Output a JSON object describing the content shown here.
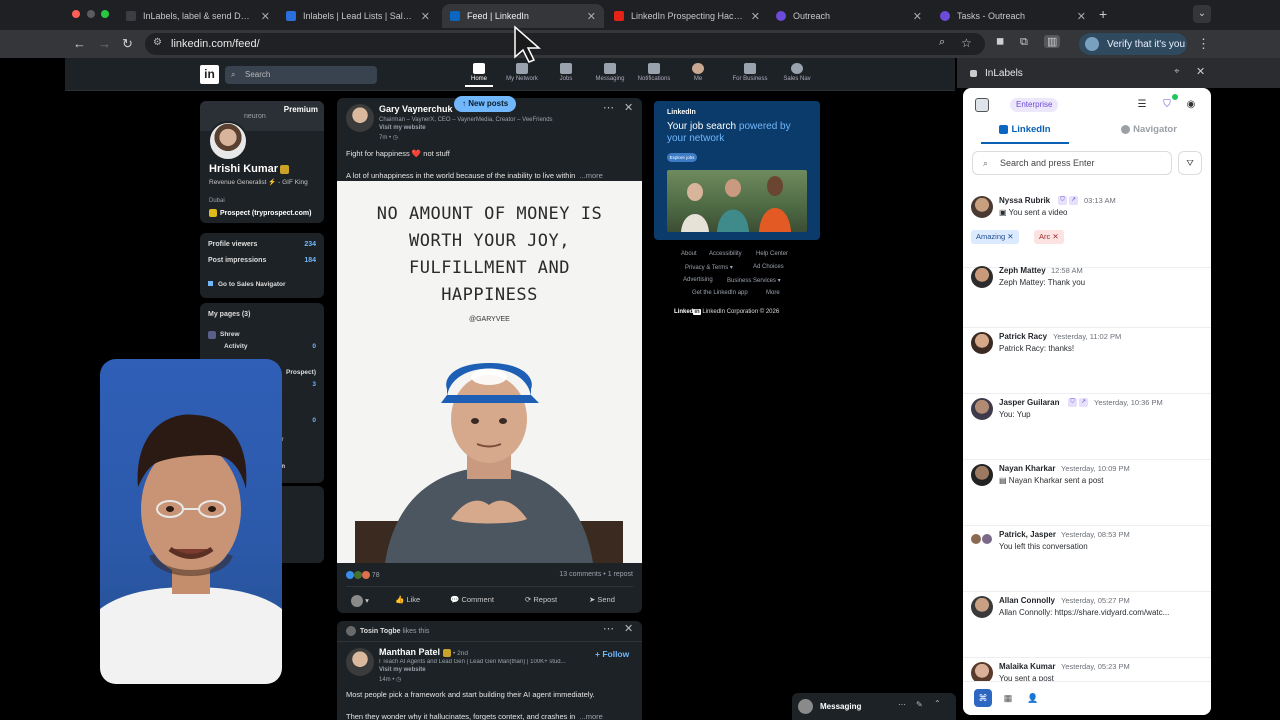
{
  "browser": {
    "tabs": [
      {
        "title": "InLabels, label & send DMs w",
        "color": "#3b3d42"
      },
      {
        "title": "Inlabels | Lead Lists | Sales N",
        "color": "#2a6fdb"
      },
      {
        "title": "Feed | LinkedIn",
        "color": "#0a66c2",
        "active": true
      },
      {
        "title": "LinkedIn Prospecting Hack to",
        "color": "#e62117"
      },
      {
        "title": "Outreach",
        "color": "#6b4bd8"
      },
      {
        "title": "Tasks - Outreach",
        "color": "#6b4bd8"
      }
    ],
    "url": "linkedin.com/feed/",
    "profile_button": "Verify that it's you"
  },
  "linkedin": {
    "search_placeholder": "Search",
    "nav": [
      "Home",
      "My Network",
      "Jobs",
      "Messaging",
      "Notifications",
      "Me",
      "For Business",
      "Sales Nav"
    ],
    "new_posts": "New posts",
    "profile": {
      "premium": "Premium",
      "banner_brand": "neuron",
      "name": "Hrishi Kumar",
      "headline": "Revenue Generalist ⚡ - GIF King",
      "location": "Dubai",
      "company": "Prospect (tryprospect.com)",
      "stats": [
        {
          "label": "Profile viewers",
          "value": "234"
        },
        {
          "label": "Post impressions",
          "value": "184"
        }
      ],
      "sales_nav": "Go to Sales Navigator",
      "pages_title": "My pages (3)",
      "pages": [
        {
          "name": "Shrew",
          "sub": "Activity",
          "count": "0"
        }
      ],
      "pages_partial": [
        "Prospect)",
        "3",
        "0",
        "er",
        "lin"
      ]
    },
    "post1": {
      "author": "Gary Vaynerchuk",
      "sub": "Chairman – VaynerX, CEO – VaynerMedia, Creator – VeeFriends",
      "visit": "Visit my website",
      "time": "7m • ◷",
      "line1": "Fight for happiness ❤️ not stuff",
      "line2": "A lot of unhappiness in the world because of the inability to live within",
      "more": "...more",
      "quote": "NO AMOUNT OF MONEY IS WORTH YOUR JOY, FULFILLMENT AND HAPPINESS",
      "signature": "@GARYVEE",
      "reactions_count": "78",
      "comments": "13 comments • 1 repost",
      "actions": [
        "Like",
        "Comment",
        "Repost",
        "Send"
      ]
    },
    "post2": {
      "liked_by": "Tosin Togbe",
      "liked_suffix": "likes this",
      "author": "Manthan Patel",
      "degree": "• 2nd",
      "follow": "+ Follow",
      "sub": "I Teach AI Agents and Lead Gen | Lead Gen Man(than) | 100K+ stud...",
      "visit": "Visit my website",
      "time": "14m • ◷",
      "line1": "Most people pick a framework and start building their AI agent immediately.",
      "line2": "Then they wonder why it hallucinates, forgets context, and crashes in",
      "more": "...more"
    },
    "ad": {
      "brand": "LinkedIn",
      "title_a": "Your job search ",
      "title_b": "powered by your network",
      "button": "Explore jobs"
    },
    "footer": [
      "About",
      "Accessibility",
      "Help Center",
      "Privacy & Terms ▾",
      "Ad Choices",
      "Advertising",
      "Business Services ▾",
      "Get the LinkedIn app",
      "More"
    ],
    "copyright": "LinkedIn Corporation © 2026",
    "messaging": "Messaging"
  },
  "inlabels": {
    "title": "InLabels",
    "plan": "Enterprise",
    "tabs": [
      "LinkedIn",
      "Navigator"
    ],
    "search_placeholder": "Search and press Enter",
    "tags": [
      "Amazing",
      "Arc"
    ],
    "conversations": [
      {
        "name": "Nyssa Rubrik",
        "time": "03:13 AM",
        "msg": "You sent a video",
        "badge": true,
        "icon": "▣"
      },
      {
        "name": "Zeph Mattey",
        "time": "12:58 AM",
        "msg": "Zeph Mattey: Thank you",
        "badge": false
      },
      {
        "name": "Patrick Racy",
        "time": "Yesterday, 11:02 PM",
        "msg": "Patrick Racy: thanks!",
        "badge": false
      },
      {
        "name": "Jasper Guilaran",
        "time": "Yesterday, 10:36 PM",
        "msg": "You: Yup",
        "badge": true
      },
      {
        "name": "Nayan Kharkar",
        "time": "Yesterday, 10:09 PM",
        "msg": "Nayan Kharkar sent a post",
        "badge": false,
        "icon": "▤"
      },
      {
        "name": "Patrick, Jasper",
        "time": "Yesterday, 08:53 PM",
        "msg": "You left this conversation",
        "badge": false
      },
      {
        "name": "Allan Connolly",
        "time": "Yesterday, 05:27 PM",
        "msg": "Allan Connolly: https://share.vidyard.com/watc...",
        "badge": false
      },
      {
        "name": "Malaika Kumar",
        "time": "Yesterday, 05:23 PM",
        "msg": "You sent a post",
        "badge": false
      }
    ],
    "colors": {
      "accent": "#0a5fb2",
      "purple": "#6b4bd8"
    }
  }
}
